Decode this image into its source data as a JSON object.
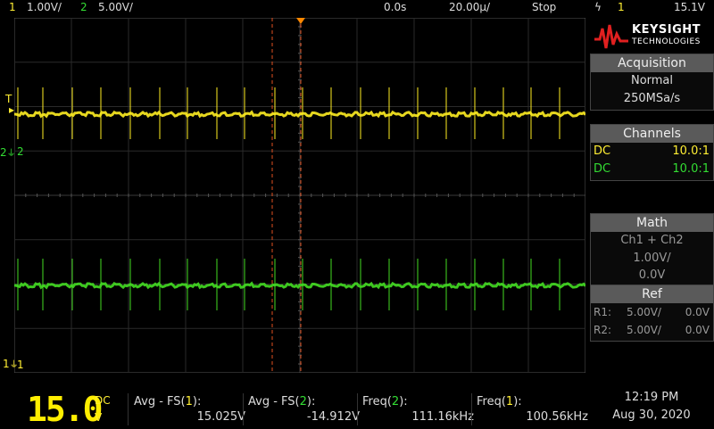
{
  "topbar": {
    "ch1_num": "1",
    "ch1_scale": "1.00V/",
    "ch2_num": "2",
    "ch2_scale": "5.00V/",
    "time_offset": "0.0s",
    "time_scale": "20.00µ/",
    "run_state": "Stop",
    "trig_icon": "ϟ",
    "trig_ch": "1",
    "trig_level": "15.1V"
  },
  "logo": {
    "brand": "KEYSIGHT",
    "sub": "TECHNOLOGIES",
    "icon": "keysight-wave-icon"
  },
  "acquisition": {
    "header": "Acquisition",
    "mode": "Normal",
    "rate": "250MSa/s"
  },
  "channels": {
    "header": "Channels",
    "rows": [
      {
        "coupling": "DC",
        "probe": "10.0:1",
        "color": "#ffee33"
      },
      {
        "coupling": "DC",
        "probe": "10.0:1",
        "color": "#33dd33"
      }
    ]
  },
  "math": {
    "header": "Math",
    "expr": "Ch1 + Ch2",
    "scale": "1.00V/",
    "offset": "0.0V"
  },
  "ref": {
    "header": "Ref",
    "rows": [
      {
        "name": "R1:",
        "scale": "5.00V/",
        "offset": "0.0V"
      },
      {
        "name": "R2:",
        "scale": "5.00V/",
        "offset": "0.0V"
      }
    ]
  },
  "markers": {
    "trig_t": "T",
    "ch2": "2",
    "ch1": "1"
  },
  "bigdisplay": {
    "value": "15.0",
    "coupling": "DC",
    "unit": "V"
  },
  "measurements": [
    {
      "label_pre": "Avg - FS(",
      "label_ch": "1",
      "label_post": "):",
      "value": "15.025V",
      "ch_color": "#ffee33"
    },
    {
      "label_pre": "Avg - FS(",
      "label_ch": "2",
      "label_post": "):",
      "value": "-14.912V",
      "ch_color": "#33dd33"
    },
    {
      "label_pre": "Freq(",
      "label_ch": "2",
      "label_post": "):",
      "value": "111.16kHz",
      "ch_color": "#33dd33"
    },
    {
      "label_pre": "Freq(",
      "label_ch": "1",
      "label_post": "):",
      "value": "100.56kHz",
      "ch_color": "#ffee33"
    }
  ],
  "clock": {
    "time": "12:19 PM",
    "date": "Aug 30, 2020"
  }
}
